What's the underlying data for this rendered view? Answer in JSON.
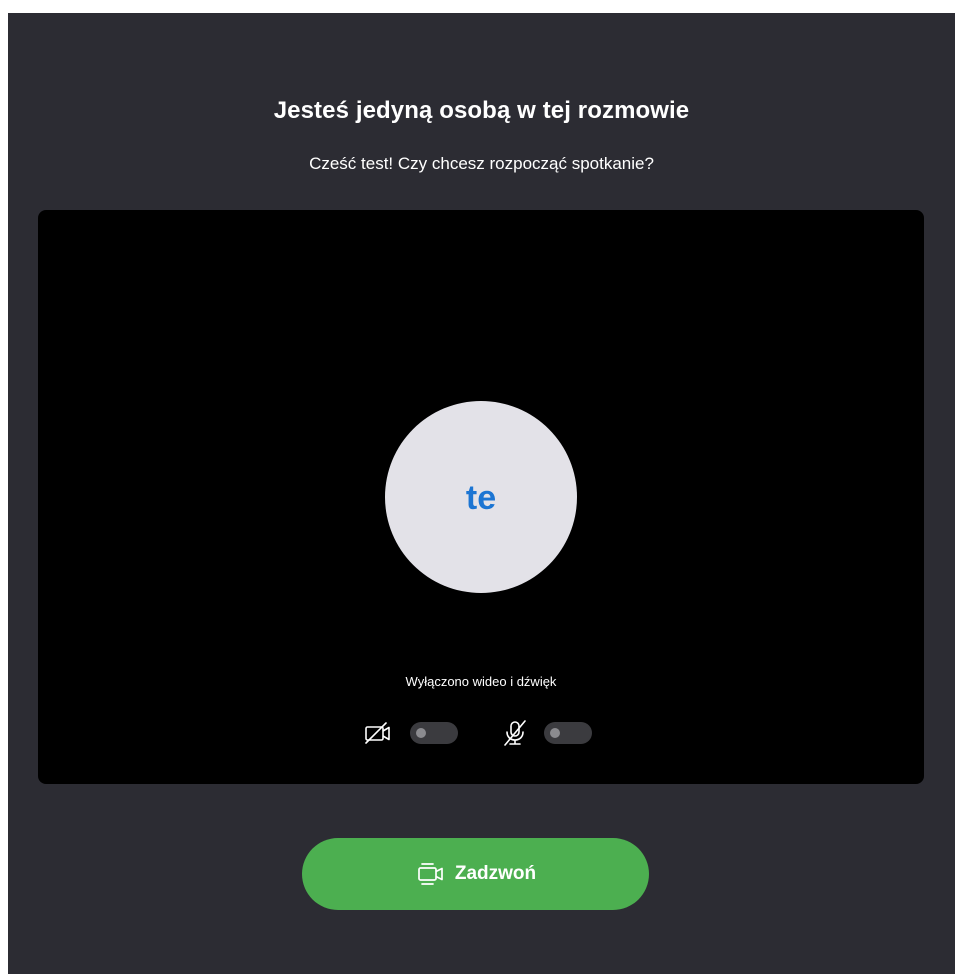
{
  "header": {
    "title": "Jesteś jedyną osobą w tej rozmowie",
    "subtitle": "Cześć test! Czy chcesz rozpocząć spotkanie?"
  },
  "preview": {
    "avatar_initials": "te",
    "status_text": "Wyłączono wideo i dźwięk",
    "video_toggle": {
      "icon": "video-off-icon",
      "state": "off"
    },
    "audio_toggle": {
      "icon": "mic-off-icon",
      "state": "off"
    }
  },
  "call_button": {
    "label": "Zadzwoń",
    "icon": "video-call-icon"
  },
  "colors": {
    "background": "#2c2c33",
    "preview_background": "#000000",
    "avatar_background": "#e3e2e8",
    "avatar_initials": "#1c75d3",
    "call_button": "#4caf50",
    "toggle_track": "#3b3b3f",
    "toggle_knob": "#8b8b8f"
  }
}
